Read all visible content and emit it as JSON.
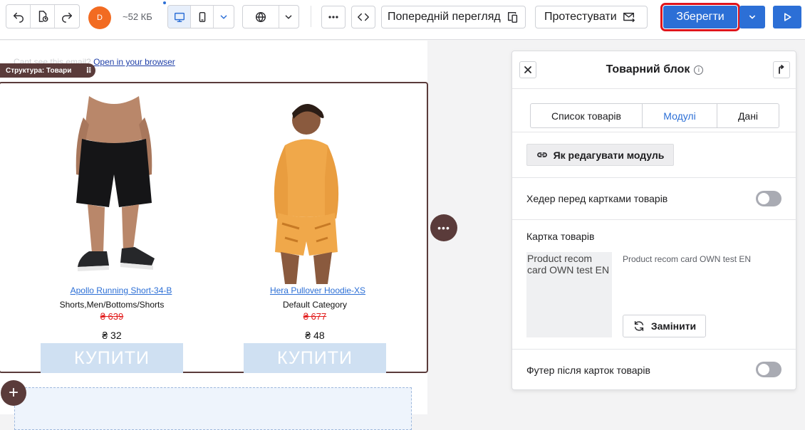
{
  "toolbar": {
    "size": "~52 КБ",
    "avatar_initial": "D",
    "preview_label": "Попередній перегляд",
    "test_label": "Протестувати",
    "save_label": "Зберегти"
  },
  "canvas": {
    "preheader_text": "Cant see this email?",
    "preheader_link": "Open in your browser",
    "structure_tag": "Структура: Товари",
    "products": [
      {
        "name": "Apollo Running Short-34-B",
        "category": "Shorts,Men/Bottoms/Shorts",
        "old_price": "₴ 639",
        "price": "₴ 32",
        "buy_label": "КУПИТИ"
      },
      {
        "name": "Hera Pullover Hoodie-XS",
        "category": "Default Category",
        "old_price": "₴ 677",
        "price": "₴ 48",
        "buy_label": "КУПИТИ"
      }
    ]
  },
  "panel": {
    "title": "Товарний блок",
    "tabs": [
      "Список товарів",
      "Модулі",
      "Дані"
    ],
    "active_tab": "Модулі",
    "howto_label": "Як редагувати модуль",
    "header_toggle_label": "Хедер перед картками товарів",
    "card_section_label": "Картка товарів",
    "card_thumb_alt": "Product recom card OWN test EN",
    "card_name": "Product recom card OWN test EN",
    "replace_label": "Замінити",
    "footer_toggle_label": "Футер після карток товарів"
  },
  "colors": {
    "accent": "#2c6fd6",
    "highlight": "#e0141b",
    "structure": "#5a3b3a",
    "old_price": "#e21b1b",
    "buy_button": "#cfe0f2"
  }
}
